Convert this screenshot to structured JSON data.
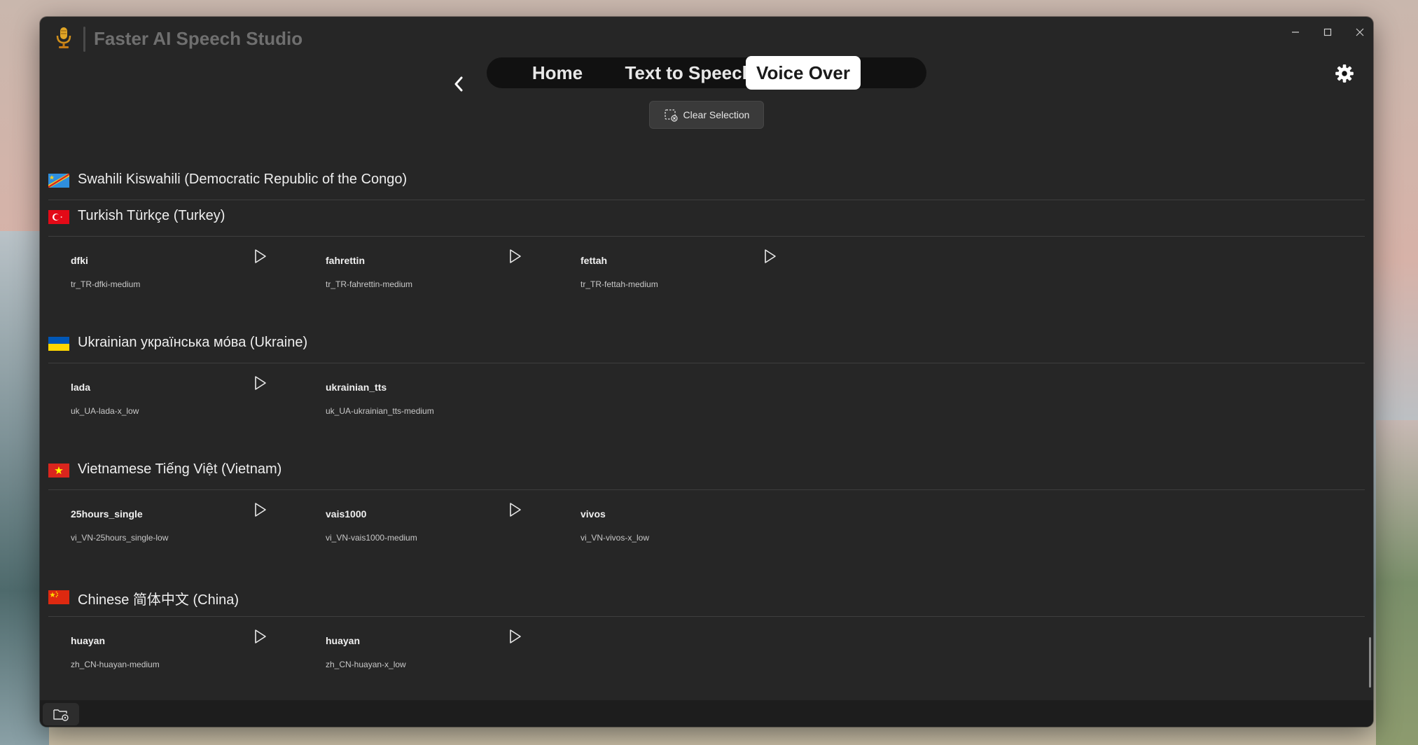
{
  "app": {
    "title": "Faster AI Speech Studio"
  },
  "nav": {
    "tabs": [
      {
        "label": "Home",
        "active": false
      },
      {
        "label": "Text to Speech",
        "active": false
      },
      {
        "label": "Voice Over",
        "active": true
      }
    ]
  },
  "toolbar": {
    "clear_selection_label": "Clear Selection"
  },
  "languages": [
    {
      "name": "Swahili Kiswahili (Democratic Republic of the Congo)",
      "flag_icon": "flag-cd-icon",
      "voices": []
    },
    {
      "name": "Turkish Türkçe (Turkey)",
      "flag_icon": "flag-tr-icon",
      "voices": [
        {
          "name": "dfki",
          "id": "tr_TR-dfki-medium",
          "has_play": true
        },
        {
          "name": "fahrettin",
          "id": "tr_TR-fahrettin-medium",
          "has_play": true
        },
        {
          "name": "fettah",
          "id": "tr_TR-fettah-medium",
          "has_play": true
        }
      ]
    },
    {
      "name": "Ukrainian українська мо́ва (Ukraine)",
      "flag_icon": "flag-ua-icon",
      "voices": [
        {
          "name": "lada",
          "id": "uk_UA-lada-x_low",
          "has_play": true
        },
        {
          "name": "ukrainian_tts",
          "id": "uk_UA-ukrainian_tts-medium",
          "has_play": false
        }
      ]
    },
    {
      "name": "Vietnamese Tiếng Việt (Vietnam)",
      "flag_icon": "flag-vn-icon",
      "voices": [
        {
          "name": "25hours_single",
          "id": "vi_VN-25hours_single-low",
          "has_play": true
        },
        {
          "name": "vais1000",
          "id": "vi_VN-vais1000-medium",
          "has_play": true
        },
        {
          "name": "vivos",
          "id": "vi_VN-vivos-x_low",
          "has_play": false
        }
      ]
    },
    {
      "name": "Chinese 简体中文 (China)",
      "flag_icon": "flag-cn-icon",
      "voices": [
        {
          "name": "huayan",
          "id": "zh_CN-huayan-medium",
          "has_play": true
        },
        {
          "name": "huayan",
          "id": "zh_CN-huayan-x_low",
          "has_play": true
        }
      ]
    }
  ],
  "icons": {
    "logo": "microphone-logo-icon",
    "back": "chevron-left-icon",
    "settings": "gear-icon",
    "clear": "selection-clear-icon",
    "play": "play-icon",
    "folder": "folder-settings-icon"
  },
  "colors": {
    "window_bg": "#262626",
    "nav_bg": "#111111",
    "active_tab_bg": "#ffffff"
  }
}
